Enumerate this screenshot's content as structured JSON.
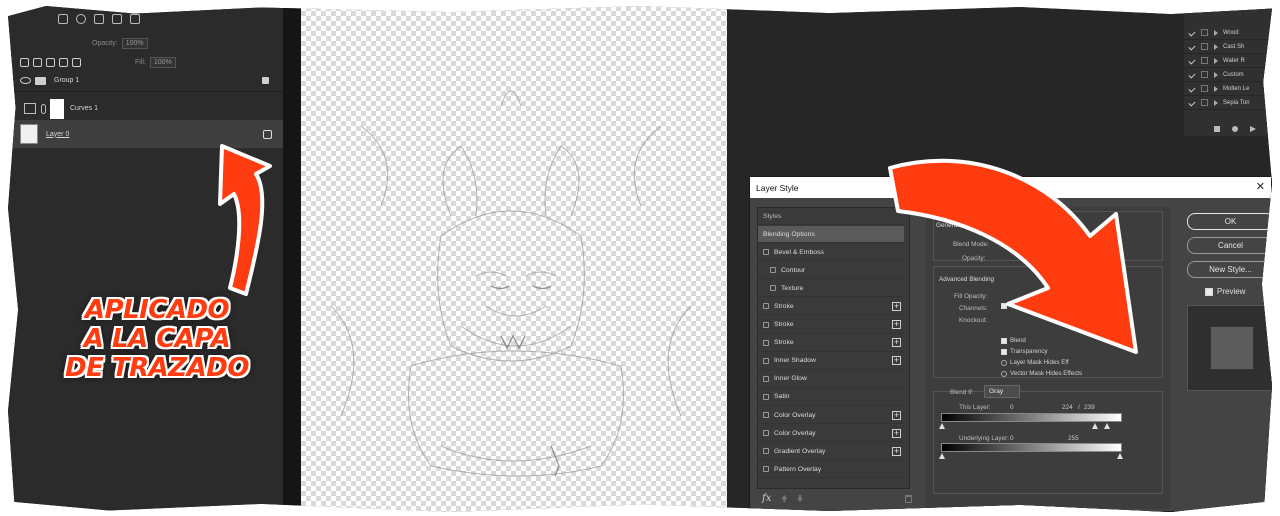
{
  "layers_panel": {
    "opacity_label": "Opacity:",
    "opacity_value": "100%",
    "fill_label": "Fill:",
    "fill_value": "100%",
    "layers": [
      {
        "name": "Group 1"
      },
      {
        "name": "Curves 1"
      },
      {
        "name": "Layer 0"
      }
    ]
  },
  "annotation": {
    "line1": "APLICADO",
    "line2": "A LA CAPA",
    "line3": "DE TRAZADO",
    "color": "#ff3b10"
  },
  "actions_panel": {
    "items": [
      "Wood",
      "Cast Sh",
      "Water R",
      "Custom",
      "Molten Le",
      "Sepia Ton"
    ]
  },
  "dialog": {
    "title": "Layer Style",
    "close": "✕",
    "styles_header": "Styles",
    "styles": [
      {
        "label": "Blending Options",
        "checkbox": false,
        "plus": false,
        "active": true,
        "indent": false
      },
      {
        "label": "Bevel & Emboss",
        "checkbox": true,
        "plus": false,
        "active": false,
        "indent": false
      },
      {
        "label": "Contour",
        "checkbox": true,
        "plus": false,
        "active": false,
        "indent": true
      },
      {
        "label": "Texture",
        "checkbox": true,
        "plus": false,
        "active": false,
        "indent": true
      },
      {
        "label": "Stroke",
        "checkbox": true,
        "plus": true,
        "active": false,
        "indent": false
      },
      {
        "label": "Stroke",
        "checkbox": true,
        "plus": true,
        "active": false,
        "indent": false
      },
      {
        "label": "Stroke",
        "checkbox": true,
        "plus": true,
        "active": false,
        "indent": false
      },
      {
        "label": "Inner Shadow",
        "checkbox": true,
        "plus": true,
        "active": false,
        "indent": false
      },
      {
        "label": "Inner Glow",
        "checkbox": true,
        "plus": false,
        "active": false,
        "indent": false
      },
      {
        "label": "Satin",
        "checkbox": true,
        "plus": false,
        "active": false,
        "indent": false
      },
      {
        "label": "Color Overlay",
        "checkbox": true,
        "plus": true,
        "active": false,
        "indent": false
      },
      {
        "label": "Color Overlay",
        "checkbox": true,
        "plus": true,
        "active": false,
        "indent": false
      },
      {
        "label": "Gradient Overlay",
        "checkbox": true,
        "plus": true,
        "active": false,
        "indent": false
      },
      {
        "label": "Pattern Overlay",
        "checkbox": true,
        "plus": false,
        "active": false,
        "indent": false
      }
    ],
    "fx": "fx",
    "general_blending": "General B",
    "blend_mode_label": "Blend Mode:",
    "opacity_label": "Opacity:",
    "advanced_blending": "Advanced Blending",
    "fill_opacity_label": "Fill Opacity:",
    "channels_label": "Channels:",
    "knockout_label": "Knockout:",
    "options": [
      {
        "label": "Blend",
        "checked": true
      },
      {
        "label": "Transparency",
        "checked": true
      },
      {
        "label": "Layer Mask Hides Eff",
        "checked": false
      },
      {
        "label": "Vector Mask Hides Effects",
        "checked": false
      }
    ],
    "blend_if_label": "Blend If:",
    "blend_if_value": "Gray",
    "this_layer_label": "This Layer:",
    "this_layer_min": "0",
    "this_layer_max_a": "224",
    "this_layer_sep": "/",
    "this_layer_max_b": "239",
    "underlying_label": "Underlying Layer:",
    "underlying_min": "0",
    "underlying_max": "255",
    "buttons": {
      "ok": "OK",
      "cancel": "Cancel",
      "new_style": "New Style..."
    },
    "preview_label": "Preview",
    "preview_checked": true
  }
}
